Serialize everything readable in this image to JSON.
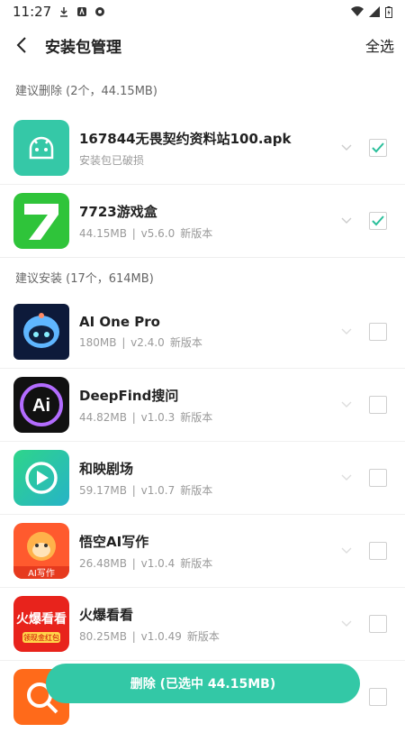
{
  "status_bar": {
    "time": "11:27"
  },
  "header": {
    "title": "安装包管理",
    "select_all": "全选"
  },
  "sections": {
    "delete": {
      "title": "建议删除 (2个，44.15MB)"
    },
    "install": {
      "title": "建议安装 (17个，614MB)"
    }
  },
  "apps": [
    {
      "name": "167844无畏契约资料站100.apk",
      "size": "安装包已破损",
      "version": "",
      "tag": "",
      "checked": true
    },
    {
      "name": "7723游戏盒",
      "size": "44.15MB",
      "version": "v5.6.0",
      "tag": "新版本",
      "checked": true
    },
    {
      "name": "AI One Pro",
      "size": "180MB",
      "version": "v2.4.0",
      "tag": "新版本",
      "checked": false
    },
    {
      "name": "DeepFind搜问",
      "size": "44.82MB",
      "version": "v1.0.3",
      "tag": "新版本",
      "checked": false
    },
    {
      "name": "和映剧场",
      "size": "59.17MB",
      "version": "v1.0.7",
      "tag": "新版本",
      "checked": false
    },
    {
      "name": "悟空AI写作",
      "size": "26.48MB",
      "version": "v1.0.4",
      "tag": "新版本",
      "checked": false
    },
    {
      "name": "火爆看看",
      "size": "80.25MB",
      "version": "v1.0.49",
      "tag": "新版本",
      "checked": false
    },
    {
      "name": "",
      "size": "",
      "version": "",
      "tag": "",
      "checked": false
    }
  ],
  "icon_text": {
    "ai": "Ai",
    "wukong": "AI写作",
    "huobao_top": "火爆看看",
    "huobao_bottom": "领现金红包"
  },
  "delete_button": {
    "label": "删除 (已选中 44.15MB)"
  },
  "colors": {
    "accent": "#33c8a6",
    "check": "#2bbf9b"
  }
}
